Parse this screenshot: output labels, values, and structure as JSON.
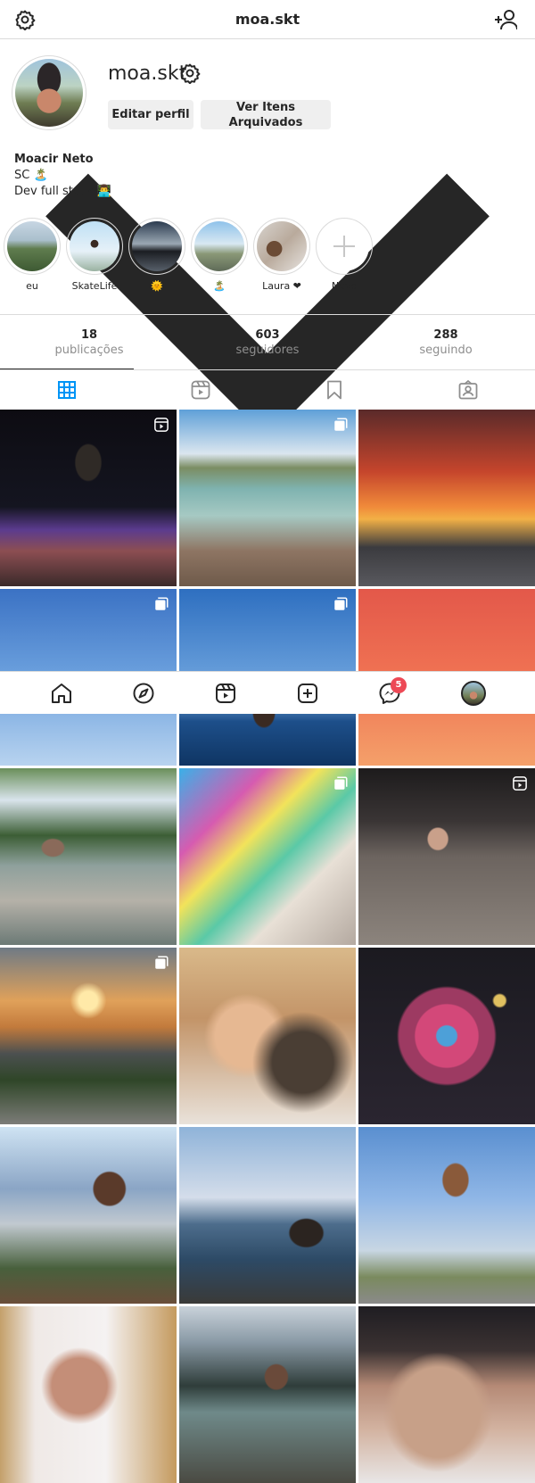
{
  "header": {
    "username": "moa.skt"
  },
  "profile": {
    "username": "moa.skt",
    "edit_label": "Editar perfil",
    "archive_label": "Ver Itens Arquivados",
    "bio_name": "Moacir Neto",
    "bio_line1": "SC 🏝️",
    "bio_line2": "Dev full stack 👨‍💻"
  },
  "highlights": [
    {
      "label": "eu"
    },
    {
      "label": "SkateLife"
    },
    {
      "label": "🌞"
    },
    {
      "label": "🏝️"
    },
    {
      "label": "Laura ❤"
    },
    {
      "label": "Novo"
    }
  ],
  "stats": [
    {
      "value": "18",
      "label": "publicações"
    },
    {
      "value": "603",
      "label": "seguidores"
    },
    {
      "value": "288",
      "label": "seguindo"
    }
  ],
  "nav": {
    "notification_count": "5"
  },
  "colors": {
    "accent": "#0095f6",
    "badge": "#ed4956",
    "text": "#262626",
    "muted": "#8e8e8e"
  }
}
